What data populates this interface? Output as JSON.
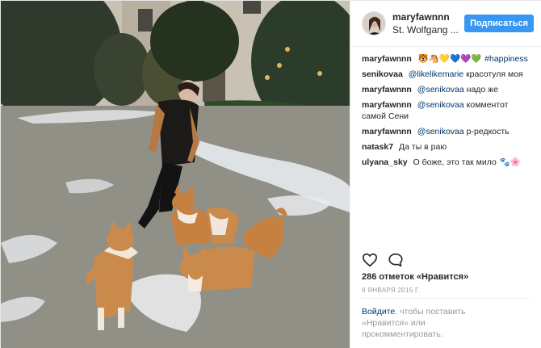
{
  "post": {
    "username": "maryfawnnn",
    "location": "St. Wolfgang ...",
    "follow_label": "Подписаться",
    "photo_alt": "image"
  },
  "comments": [
    {
      "user": "maryfawnnn",
      "text": "",
      "emoji": "🐯🐴💛💙💜💚",
      "hashtag": "#happiness"
    },
    {
      "user": "senikovaa",
      "mention": "@likelikemarie",
      "text": "красотуля моя"
    },
    {
      "user": "maryfawnnn",
      "mention": "@senikovaa",
      "text": "надо же"
    },
    {
      "user": "maryfawnnn",
      "mention": "@senikovaa",
      "text": "комментот самой Сени"
    },
    {
      "user": "maryfawnnn",
      "mention": "@senikovaa",
      "text": "р-редкость"
    },
    {
      "user": "natask7",
      "text": "Да ты в раю"
    },
    {
      "user": "ulyana_sky",
      "text": "О боже, это так мило",
      "emoji": "🐾🌸"
    }
  ],
  "actions": {
    "like_icon": "heart-icon",
    "comment_icon": "speech-bubble-icon"
  },
  "likes_text": "286 отметок «Нравится»",
  "date_text": "9 ЯНВАРЯ 2015 Г.",
  "login_prompt": {
    "link": "Войдите",
    "rest_line1": ", чтобы поставить",
    "rest_line2": "«Нравится» или",
    "rest_line3": "прокомментировать."
  },
  "colors": {
    "accent": "#3897f0",
    "link": "#003569",
    "muted": "#999999"
  }
}
